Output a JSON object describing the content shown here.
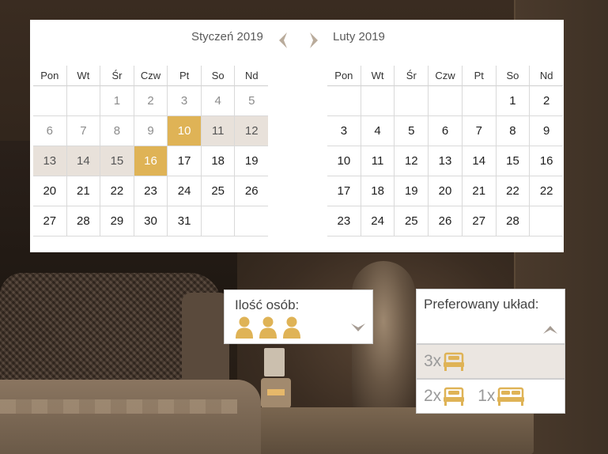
{
  "colors": {
    "accent": "#dfb356",
    "range": "#e8e1da",
    "muted": "#8c8c8c"
  },
  "calendar": {
    "nav_prev_icon": "chevron-left-icon",
    "nav_next_icon": "chevron-right-icon",
    "weekdays": [
      "Pon",
      "Wt",
      "Śr",
      "Czw",
      "Pt",
      "So",
      "Nd"
    ],
    "months": [
      {
        "title": "Styczeń 2019",
        "weeks": [
          [
            {
              "d": ""
            },
            {
              "d": ""
            },
            {
              "d": "1",
              "s": "past"
            },
            {
              "d": "2",
              "s": "past"
            },
            {
              "d": "3",
              "s": "past"
            },
            {
              "d": "4",
              "s": "past"
            },
            {
              "d": "5",
              "s": "past"
            }
          ],
          [
            {
              "d": "6",
              "s": "past"
            },
            {
              "d": "7",
              "s": "past"
            },
            {
              "d": "8",
              "s": "past"
            },
            {
              "d": "9",
              "s": "past"
            },
            {
              "d": "10",
              "s": "selected"
            },
            {
              "d": "11",
              "s": "inrange"
            },
            {
              "d": "12",
              "s": "inrange"
            }
          ],
          [
            {
              "d": "13",
              "s": "inrange"
            },
            {
              "d": "14",
              "s": "inrange"
            },
            {
              "d": "15",
              "s": "inrange"
            },
            {
              "d": "16",
              "s": "selected"
            },
            {
              "d": "17"
            },
            {
              "d": "18"
            },
            {
              "d": "19"
            }
          ],
          [
            {
              "d": "20"
            },
            {
              "d": "21"
            },
            {
              "d": "22"
            },
            {
              "d": "23"
            },
            {
              "d": "24"
            },
            {
              "d": "25"
            },
            {
              "d": "26"
            }
          ],
          [
            {
              "d": "27"
            },
            {
              "d": "28"
            },
            {
              "d": "29"
            },
            {
              "d": "30"
            },
            {
              "d": "31"
            },
            {
              "d": ""
            },
            {
              "d": ""
            }
          ]
        ]
      },
      {
        "title": "Luty 2019",
        "weeks": [
          [
            {
              "d": ""
            },
            {
              "d": ""
            },
            {
              "d": ""
            },
            {
              "d": ""
            },
            {
              "d": ""
            },
            {
              "d": "1"
            },
            {
              "d": "2"
            }
          ],
          [
            {
              "d": "3"
            },
            {
              "d": "4"
            },
            {
              "d": "5"
            },
            {
              "d": "6"
            },
            {
              "d": "7"
            },
            {
              "d": "8"
            },
            {
              "d": "9"
            }
          ],
          [
            {
              "d": "10"
            },
            {
              "d": "11"
            },
            {
              "d": "12"
            },
            {
              "d": "13"
            },
            {
              "d": "14"
            },
            {
              "d": "15"
            },
            {
              "d": "16"
            }
          ],
          [
            {
              "d": "17"
            },
            {
              "d": "18"
            },
            {
              "d": "19"
            },
            {
              "d": "20"
            },
            {
              "d": "21"
            },
            {
              "d": "22"
            },
            {
              "d": "22"
            }
          ],
          [
            {
              "d": "23"
            },
            {
              "d": "24"
            },
            {
              "d": "25"
            },
            {
              "d": "26"
            },
            {
              "d": "27"
            },
            {
              "d": "28"
            },
            {
              "d": ""
            }
          ]
        ]
      }
    ]
  },
  "persons": {
    "label": "Ilość osób:",
    "count": 3,
    "icon": "person-icon",
    "chevron_icon": "chevron-down-icon"
  },
  "layout": {
    "label": "Preferowany układ:",
    "chevron_icon": "chevron-up-icon",
    "options": [
      {
        "parts": [
          {
            "count": "3x",
            "icon": "single-bed-icon"
          }
        ]
      },
      {
        "parts": [
          {
            "count": "2x",
            "icon": "single-bed-icon"
          },
          {
            "count": "1x",
            "icon": "double-bed-icon"
          }
        ]
      }
    ]
  }
}
